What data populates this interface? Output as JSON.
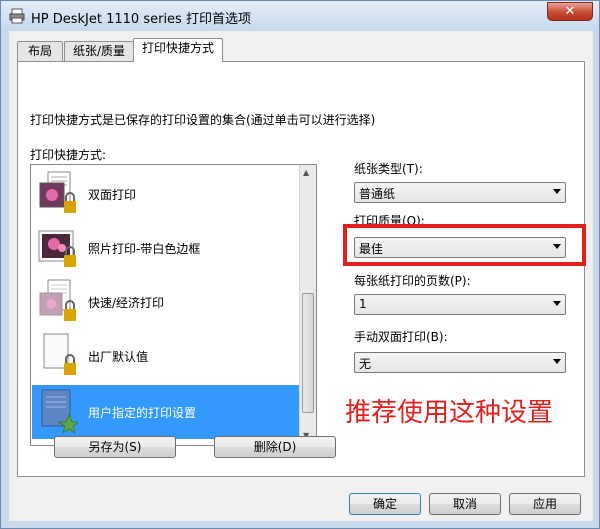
{
  "window": {
    "title": "HP DeskJet 1110 series 打印首选项",
    "close_glyph": "✕"
  },
  "tabs": [
    {
      "label": "布局",
      "active": false
    },
    {
      "label": "纸张/质量",
      "active": false
    },
    {
      "label": "打印快捷方式",
      "active": true
    }
  ],
  "panel": {
    "description": "打印快捷方式是已保存的打印设置的集合(通过单击可以进行选择)",
    "list_label": "打印快捷方式:",
    "shortcuts": [
      {
        "label": "双面打印",
        "icon": "duplex-icon",
        "selected": false
      },
      {
        "label": "照片打印-带白色边框",
        "icon": "photo-icon",
        "selected": false
      },
      {
        "label": "快速/经济打印",
        "icon": "economy-icon",
        "selected": false
      },
      {
        "label": "出厂默认值",
        "icon": "default-icon",
        "selected": false
      },
      {
        "label": "用户指定的打印设置",
        "icon": "user-settings-icon",
        "selected": true
      }
    ],
    "save_as_button": "另存为(S)",
    "delete_button": "删除(D)"
  },
  "settings": {
    "paper_type": {
      "label": "纸张类型(T):",
      "value": "普通纸"
    },
    "print_quality": {
      "label": "打印质量(Q):",
      "value": "最佳"
    },
    "pages_per_sheet": {
      "label": "每张纸打印的页数(P):",
      "value": "1"
    },
    "manual_duplex": {
      "label": "手动双面打印(B):",
      "value": "无"
    }
  },
  "annotation": {
    "text": "推荐使用这种设置",
    "color": "#e3201b"
  },
  "footer": {
    "ok_button": "确定",
    "cancel_button": "取消",
    "apply_button": "应用"
  },
  "colors": {
    "selection": "#3399ff",
    "highlight_border": "#e3201b"
  }
}
